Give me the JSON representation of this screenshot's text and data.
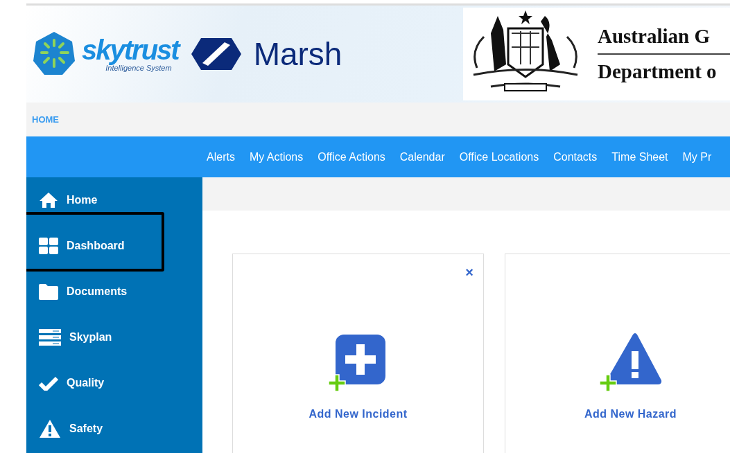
{
  "banner": {
    "brand": "skytrust",
    "tagline": "Intelligence System",
    "partner": "Marsh",
    "government": "Australian G",
    "department": "Department o"
  },
  "breadcrumb": "HOME",
  "nav": [
    "Alerts",
    "My Actions",
    "Office Actions",
    "Calendar",
    "Office Locations",
    "Contacts",
    "Time Sheet",
    "My Pr"
  ],
  "sidebar": {
    "items": [
      {
        "label": "Home",
        "kind": "home",
        "highlighted": false
      },
      {
        "label": "Dashboard",
        "kind": "dashboard",
        "highlighted": true
      },
      {
        "label": "Documents",
        "kind": "folder",
        "highlighted": false
      },
      {
        "label": "Skyplan",
        "kind": "server",
        "highlighted": false
      },
      {
        "label": "Quality",
        "kind": "check",
        "highlighted": false
      },
      {
        "label": "Safety",
        "kind": "warning",
        "highlighted": false
      }
    ]
  },
  "cards": [
    {
      "label": "Add New Incident",
      "kind": "incident",
      "close": "×"
    },
    {
      "label": "Add New Hazard",
      "kind": "hazard"
    }
  ]
}
